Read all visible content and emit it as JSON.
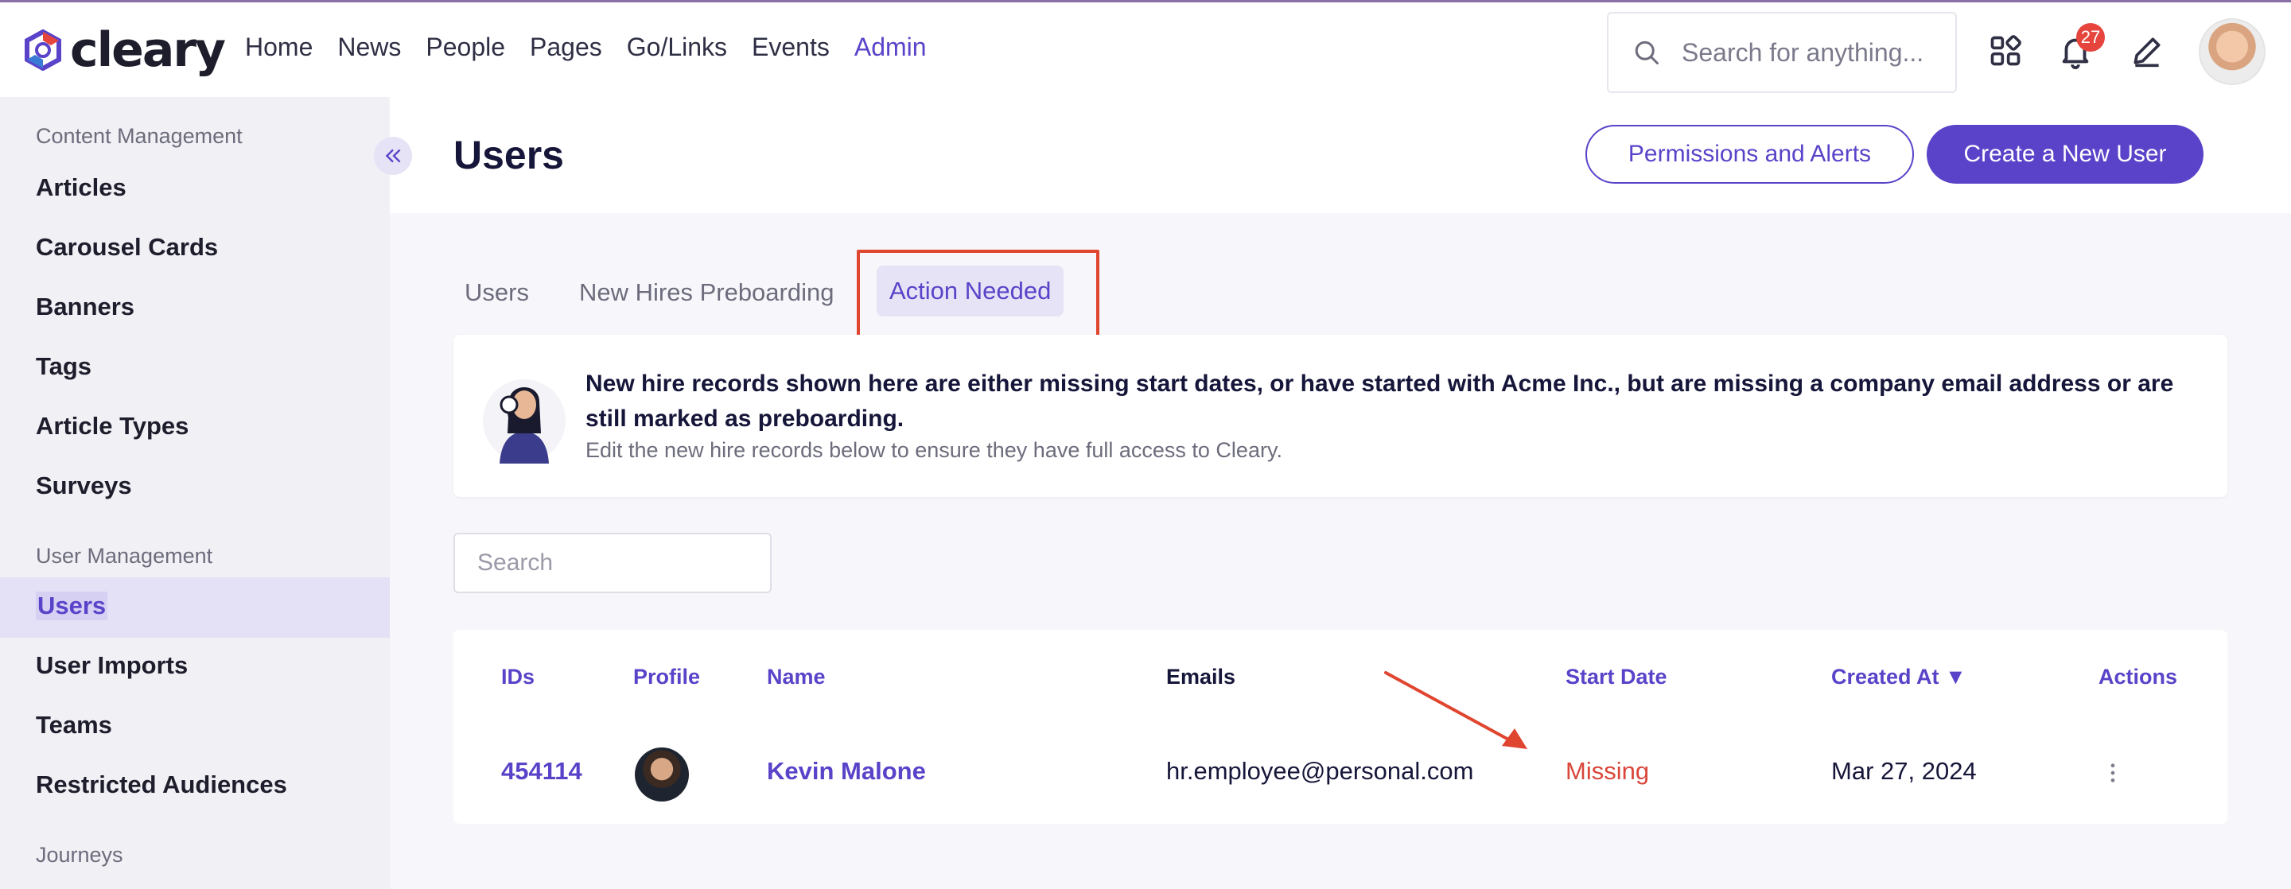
{
  "app": {
    "brand": "cleary"
  },
  "nav": {
    "items": [
      "Home",
      "News",
      "People",
      "Pages",
      "Go/Links",
      "Events",
      "Admin"
    ],
    "active": "Admin"
  },
  "header_search": {
    "placeholder": "Search for anything..."
  },
  "notifications": {
    "count": "27"
  },
  "icons": {
    "search": "search-icon",
    "apps": "apps-grid-icon",
    "notifications": "bell-icon",
    "compose": "pencil-icon",
    "collapse": "double-chevron-left-icon",
    "actions": "vertical-ellipsis-icon"
  },
  "sidebar": {
    "sections": [
      {
        "title": "Content Management",
        "items": [
          "Articles",
          "Carousel Cards",
          "Banners",
          "Tags",
          "Article Types",
          "Surveys"
        ]
      },
      {
        "title": "User Management",
        "items": [
          "Users",
          "User Imports",
          "Teams",
          "Restricted Audiences"
        ]
      },
      {
        "title": "Journeys",
        "items": []
      }
    ],
    "active_item": "Users"
  },
  "page": {
    "title": "Users",
    "permissions_button": "Permissions and Alerts",
    "create_button": "Create a New User"
  },
  "tabs": [
    {
      "label": "Users"
    },
    {
      "label": "New Hires Preboarding"
    },
    {
      "label": "Action Needed"
    }
  ],
  "active_tab": "Action Needed",
  "notice": {
    "heading": "New hire records shown here are either missing start dates, or have started with Acme Inc., but are missing a company email address or are still marked as preboarding.",
    "subtext": "Edit the new hire records below to ensure they have full access to Cleary."
  },
  "table_search": {
    "placeholder": "Search"
  },
  "table": {
    "columns": [
      "IDs",
      "Profile",
      "Name",
      "Emails",
      "Start Date",
      "Created At",
      "Actions"
    ],
    "sort_indicator": "▼",
    "rows": [
      {
        "id": "454114",
        "name": "Kevin Malone",
        "email": "hr.employee@personal.com",
        "start_date": "Missing",
        "created_at": "Mar 27, 2024"
      }
    ]
  },
  "colors": {
    "accent": "#5a43c9",
    "highlight": "#e0452f",
    "missing": "#d9463a",
    "badge": "#e5453c"
  }
}
